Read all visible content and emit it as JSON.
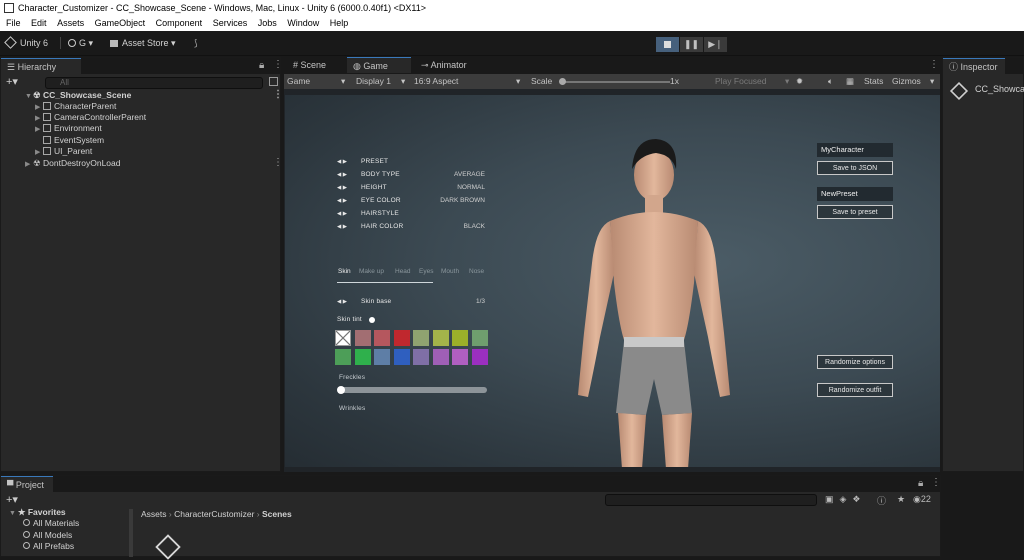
{
  "window": {
    "title": "Character_Customizer - CC_Showcase_Scene - Windows, Mac, Linux - Unity 6 (6000.0.40f1) <DX11>"
  },
  "menu": [
    "File",
    "Edit",
    "Assets",
    "GameObject",
    "Component",
    "Services",
    "Jobs",
    "Window",
    "Help"
  ],
  "toolbar": {
    "unity_label": "Unity 6",
    "account_label": "G",
    "asset_store_label": "Asset Store"
  },
  "hierarchy": {
    "tab_label": "Hierarchy",
    "search_placeholder": "All",
    "rows": [
      {
        "label": "CC_Showcase_Scene",
        "kind": "scene"
      },
      {
        "label": "CharacterParent",
        "kind": "object"
      },
      {
        "label": "CameraControllerParent",
        "kind": "object"
      },
      {
        "label": "Environment",
        "kind": "object"
      },
      {
        "label": "EventSystem",
        "kind": "object"
      },
      {
        "label": "UI_Parent",
        "kind": "object"
      },
      {
        "label": "DontDestroyOnLoad",
        "kind": "scene"
      }
    ]
  },
  "center_tabs": [
    "Scene",
    "Game",
    "Animator"
  ],
  "game_toolbar": {
    "mode": "Game",
    "display": "Display 1",
    "aspect": "16:9 Aspect",
    "scale_label": "Scale",
    "scale_value": "1x",
    "play_focused": "Play Focused",
    "stats": "Stats",
    "gizmos": "Gizmos"
  },
  "game_ui": {
    "options": [
      {
        "label": "PRESET",
        "value": ""
      },
      {
        "label": "BODY TYPE",
        "value": "AVERAGE"
      },
      {
        "label": "HEIGHT",
        "value": "NORMAL"
      },
      {
        "label": "EYE COLOR",
        "value": "DARK BROWN"
      },
      {
        "label": "HAIRSTYLE",
        "value": ""
      },
      {
        "label": "HAIR COLOR",
        "value": "BLACK"
      }
    ],
    "category_tabs": [
      "Skin",
      "Make up",
      "Head",
      "Eyes",
      "Mouth",
      "Nose"
    ],
    "skin_base_label": "Skin base",
    "skin_base_value": "1/3",
    "skin_tint_label": "Skin tint",
    "swatch_colors": [
      "#ffffff",
      "#a26e72",
      "#b5575e",
      "#c0282e",
      "#8fa370",
      "#a3b44a",
      "#9bb02a",
      "#6f9e6e",
      "#4d9e58",
      "#2fb04c",
      "#5e7ea6",
      "#2f5fbf",
      "#7f6fa6",
      "#9f5fb6",
      "#b05fc0",
      "#9b2fc0"
    ],
    "freckles_label": "Freckles",
    "wrinkles_label": "Wrinkles",
    "character_name": "MyCharacter",
    "save_json_label": "Save to JSON",
    "preset_name": "NewPreset",
    "save_preset_label": "Save to preset",
    "randomize_options_label": "Randomize options",
    "randomize_outfit_label": "Randomize outfit"
  },
  "inspector": {
    "tab_label": "Inspector",
    "object_name": "CC_Showca"
  },
  "project": {
    "tab_label": "Project",
    "favorites_label": "Favorites",
    "favorites": [
      "All Materials",
      "All Models",
      "All Prefabs"
    ],
    "breadcrumb": [
      "Assets",
      "CharacterCustomizer",
      "Scenes"
    ],
    "hidden_count": "22"
  },
  "colors": {
    "accent": "#3a79bb",
    "background": "#191919",
    "panel": "#282828"
  }
}
